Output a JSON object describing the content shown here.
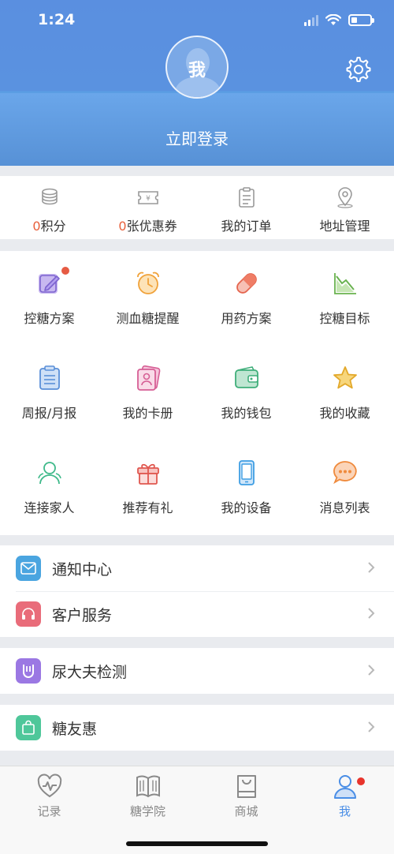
{
  "status_bar": {
    "time": "1:24"
  },
  "header": {
    "avatar_text": "我",
    "login_label": "立即登录"
  },
  "account": [
    {
      "count": "0",
      "label": "积分",
      "icon": "coins-icon"
    },
    {
      "count": "0",
      "label": "张优惠券",
      "icon": "coupon-icon"
    },
    {
      "count": "",
      "label": "我的订单",
      "icon": "clipboard-icon"
    },
    {
      "count": "",
      "label": "地址管理",
      "icon": "location-pin-icon"
    }
  ],
  "features": [
    {
      "label": "控糖方案",
      "icon": "edit-note-icon",
      "badge": true
    },
    {
      "label": "测血糖提醒",
      "icon": "alarm-clock-icon"
    },
    {
      "label": "用药方案",
      "icon": "pill-icon"
    },
    {
      "label": "控糖目标",
      "icon": "trend-chart-icon"
    },
    {
      "label": "周报/月报",
      "icon": "report-icon"
    },
    {
      "label": "我的卡册",
      "icon": "card-album-icon"
    },
    {
      "label": "我的钱包",
      "icon": "wallet-icon"
    },
    {
      "label": "我的收藏",
      "icon": "star-icon"
    },
    {
      "label": "连接家人",
      "icon": "family-icon"
    },
    {
      "label": "推荐有礼",
      "icon": "gift-icon"
    },
    {
      "label": "我的设备",
      "icon": "device-icon"
    },
    {
      "label": "消息列表",
      "icon": "message-icon"
    }
  ],
  "menu": {
    "notification_center": "通知中心",
    "customer_service": "客户服务",
    "urine_test": "尿大夫检测",
    "sugar_friends": "糖友惠"
  },
  "tabbar": [
    {
      "label": "记录",
      "icon": "heartbeat-icon",
      "active": false
    },
    {
      "label": "糖学院",
      "icon": "book-icon",
      "active": false
    },
    {
      "label": "商城",
      "icon": "shopping-bag-icon",
      "active": false
    },
    {
      "label": "我",
      "icon": "user-icon",
      "active": true
    }
  ],
  "colors": {
    "header_blue": "#5a8fe0",
    "accent_orange": "#e8603c",
    "active_tab": "#4a8ee6",
    "badge_red": "#e8342c"
  }
}
